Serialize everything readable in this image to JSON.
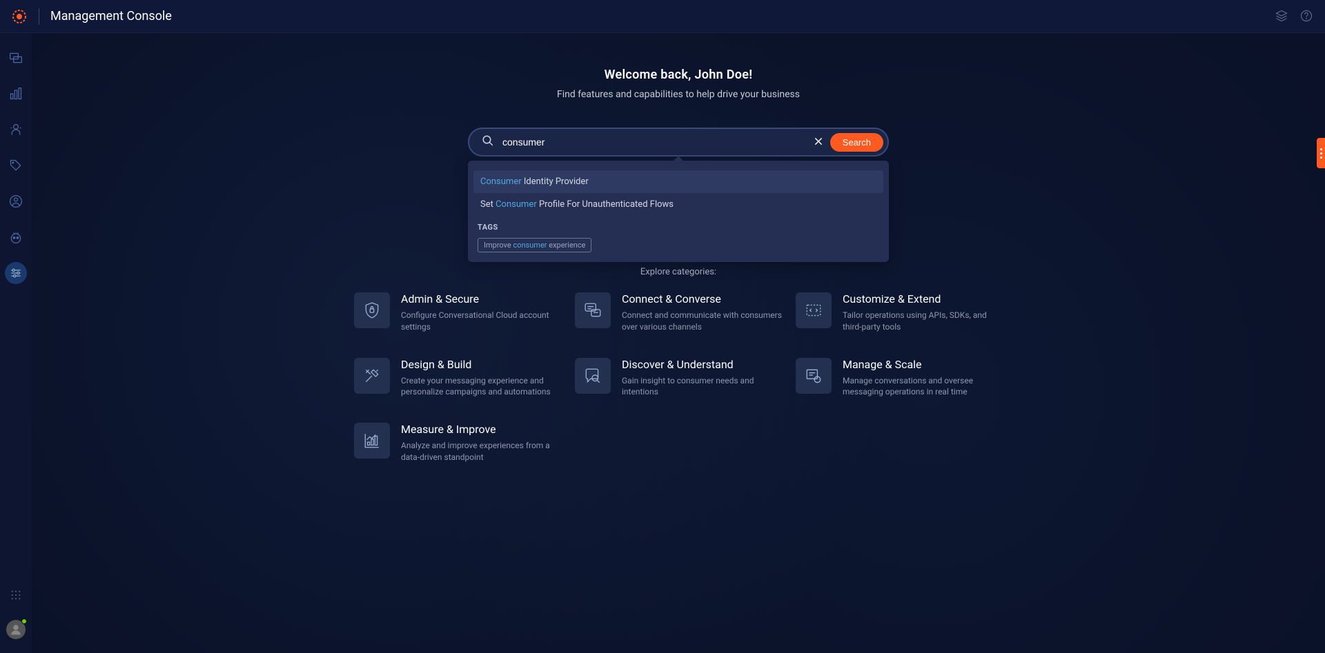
{
  "header": {
    "title": "Management Console"
  },
  "welcome": {
    "title": "Welcome back, John Doe!",
    "subtitle": "Find features and capabilities to help drive your business"
  },
  "search": {
    "value": "consumer",
    "button_label": "Search"
  },
  "suggestions": {
    "items": [
      {
        "match": "Consumer",
        "rest": " Identity Provider"
      },
      {
        "prefix": "Set ",
        "match": "Consumer",
        "rest": " Profile For Unauthenticated Flows"
      }
    ],
    "tags_heading": "TAGS",
    "tags": [
      {
        "prefix": "Improve ",
        "match": "consumer",
        "rest": " experience"
      }
    ]
  },
  "explore_label": "Explore categories:",
  "categories": [
    {
      "title": "Admin & Secure",
      "desc": "Configure Conversational Cloud account settings"
    },
    {
      "title": "Connect & Converse",
      "desc": "Connect and communicate with consumers over various channels"
    },
    {
      "title": "Customize & Extend",
      "desc": "Tailor operations using APIs, SDKs, and third-party tools"
    },
    {
      "title": "Design & Build",
      "desc": "Create your messaging experience and personalize campaigns and automations"
    },
    {
      "title": "Discover & Understand",
      "desc": "Gain insight to consumer needs and intentions"
    },
    {
      "title": "Manage & Scale",
      "desc": "Manage conversations and oversee messaging operations in real time"
    },
    {
      "title": "Measure & Improve",
      "desc": "Analyze and improve experiences from a data-driven standpoint"
    }
  ]
}
